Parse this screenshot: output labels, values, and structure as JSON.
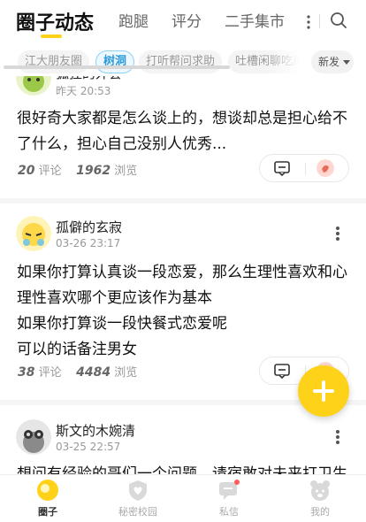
{
  "top_tabs": [
    {
      "label": "圈子动态",
      "active": true
    },
    {
      "label": "跑腿",
      "active": false
    },
    {
      "label": "评分",
      "active": false
    },
    {
      "label": "二手集市",
      "active": false
    }
  ],
  "chips": [
    {
      "label": "江大朋友圈",
      "active": false
    },
    {
      "label": "树洞",
      "active": true
    },
    {
      "label": "打听帮问求助",
      "active": false
    },
    {
      "label": "吐槽闲聊吃瓜",
      "active": false
    }
  ],
  "sort": {
    "label": "新发"
  },
  "posts": [
    {
      "author": "狐狸的外套",
      "time": "昨天 20:53",
      "lines": [
        "很好奇大家都是怎么谈上的，想谈却总是担心给不",
        "了什么，担心自己没别人优秀..."
      ],
      "comments": "20",
      "comments_label": "评论",
      "views": "1962",
      "views_label": "浏览"
    },
    {
      "author": "孤僻的玄寂",
      "time": "03-26 23:17",
      "lines": [
        "如果你打算认真谈一段恋爱，那么生理性喜欢和心",
        "理性喜欢哪个更应该作为基本",
        "如果你打算谈一段快餐式恋爱呢",
        "可以的话备注男女"
      ],
      "comments": "38",
      "comments_label": "评论",
      "views": "4484",
      "views_label": "浏览"
    },
    {
      "author": "斯文的木婉清",
      "time": "03-25 22:57",
      "lines": [
        "想问有经验的哥们一个问题，请宿敢对未来打卫生"
      ],
      "comments": "",
      "comments_label": "",
      "views": "",
      "views_label": ""
    }
  ],
  "bottom_nav": [
    {
      "label": "圈子",
      "active": true
    },
    {
      "label": "秘密校园",
      "active": false
    },
    {
      "label": "私信",
      "active": false
    },
    {
      "label": "我的",
      "active": false
    }
  ],
  "colors": {
    "accent": "#ffd21a",
    "chip_active": "#2e9bd9",
    "muted": "#999999"
  }
}
